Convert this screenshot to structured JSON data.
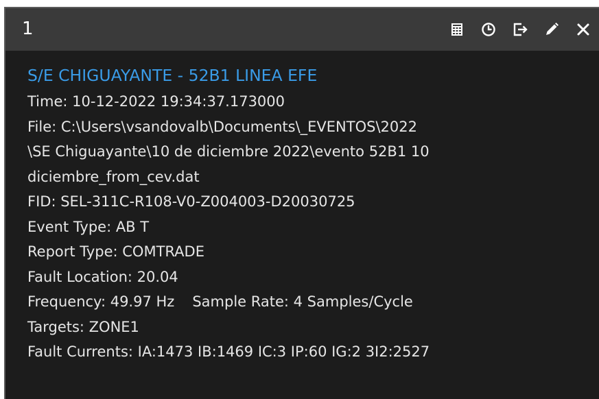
{
  "window": {
    "title": "1"
  },
  "toolbar": {
    "icons": [
      "table-icon",
      "clock-icon",
      "export-icon",
      "pencil-icon",
      "close-icon"
    ]
  },
  "event": {
    "title": "S/E CHIGUAYANTE - 52B1 LINEA EFE",
    "time": "Time:  10-12-2022 19:34:37.173000",
    "file_line1": "File: C:\\Users\\vsandovalb\\Documents\\_EVENTOS\\2022",
    "file_line2": "\\SE Chiguayante\\10 de diciembre 2022\\evento 52B1 10",
    "file_line3": "diciembre_from_cev.dat",
    "fid": "FID: SEL-311C-R108-V0-Z004003-D20030725",
    "event_type": "Event Type: AB T",
    "report_type": "Report Type: COMTRADE",
    "fault_location": "Fault Location: 20.04",
    "frequency": "Frequency: 49.97 Hz",
    "sample_rate": "Sample Rate: 4 Samples/Cycle",
    "targets": "Targets: ZONE1",
    "fault_currents": "Fault Currents: IA:1473 IB:1469 IC:3 IP:60 IG:2 3I2:2527"
  },
  "colors": {
    "panel_bg": "#1c1c1c",
    "header_bg": "#3a3a3a",
    "accent_title": "#3a9ce8",
    "text": "#e6e6e6"
  }
}
